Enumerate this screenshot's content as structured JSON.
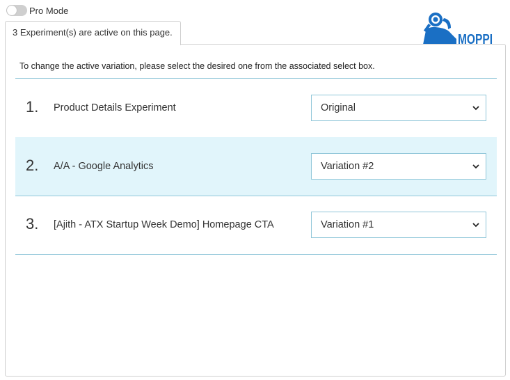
{
  "top": {
    "pro_mode_label": "Pro Mode",
    "pro_mode_on": false
  },
  "tab": {
    "label": "3 Experiment(s) are active on this page."
  },
  "logo": {
    "text": "MOPPI",
    "color": "#1a6fc4"
  },
  "panel": {
    "instruction": "To change the active variation, please select the desired one from the associated select box."
  },
  "experiments": [
    {
      "number": "1.",
      "name": "Product Details Experiment",
      "selected_variation": "Original",
      "highlighted": false
    },
    {
      "number": "2.",
      "name": "A/A - Google Analytics",
      "selected_variation": "Variation #2",
      "highlighted": true
    },
    {
      "number": "3.",
      "name": "[Ajith - ATX Startup Week Demo] Homepage CTA",
      "selected_variation": "Variation #1",
      "highlighted": false
    }
  ],
  "colors": {
    "accent_border": "#8ec5d8",
    "highlight_row": "#e1f5fb",
    "toggle_off": "#cfcfcf"
  }
}
